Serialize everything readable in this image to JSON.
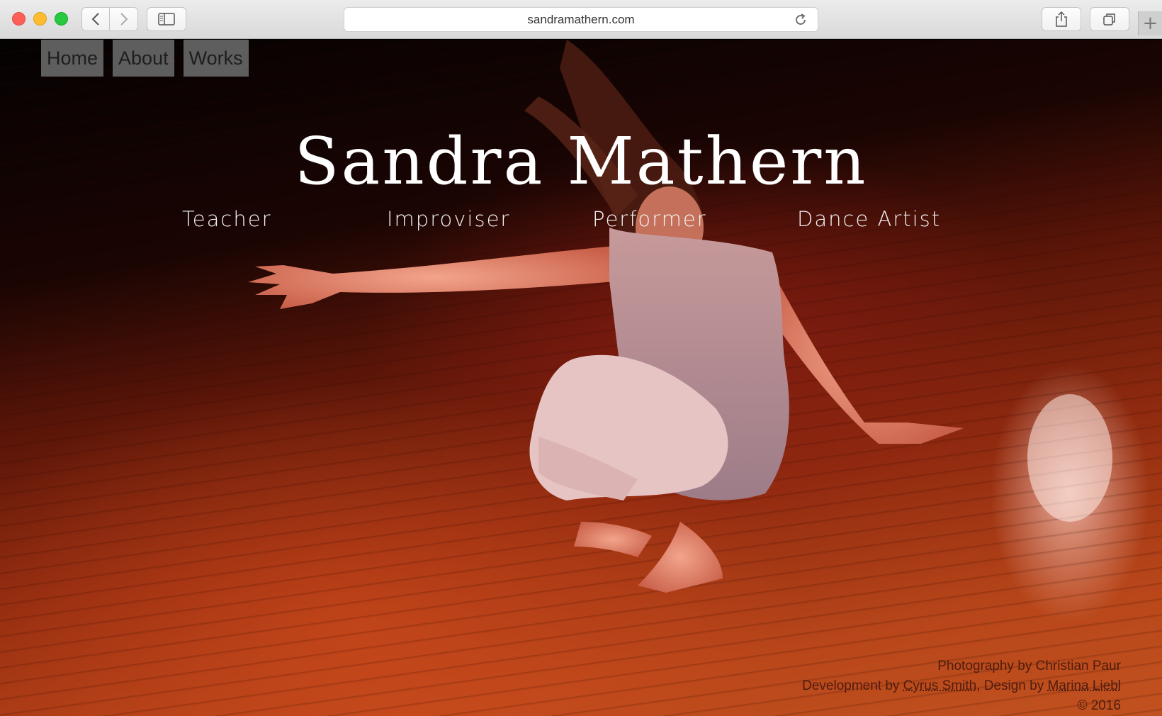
{
  "browser": {
    "url": "sandramathern.com",
    "icons": {
      "back": "chevron-left-icon",
      "forward": "chevron-right-icon",
      "sidebar": "sidebar-icon",
      "reload": "reload-icon",
      "share": "share-icon",
      "tabs": "tabs-overview-icon",
      "new_tab": "plus-icon"
    }
  },
  "nav": {
    "items": [
      {
        "label": "Home"
      },
      {
        "label": "About"
      },
      {
        "label": "Works"
      }
    ]
  },
  "hero": {
    "title": "Sandra Mathern",
    "roles": [
      "Teacher",
      "Improviser",
      "Performer",
      "Dance Artist"
    ]
  },
  "footer": {
    "photo_credit": "Photography by Christian Paur",
    "dev_prefix": "Development by ",
    "dev_name": "Cyrus Smith",
    "design_prefix": ", Design by ",
    "design_name": "Marina Liebl",
    "copyright": "© 2016"
  },
  "colors": {
    "nav_bg": "#6e6e6e",
    "title": "#ffffff",
    "floor_accent": "#c1521f"
  }
}
